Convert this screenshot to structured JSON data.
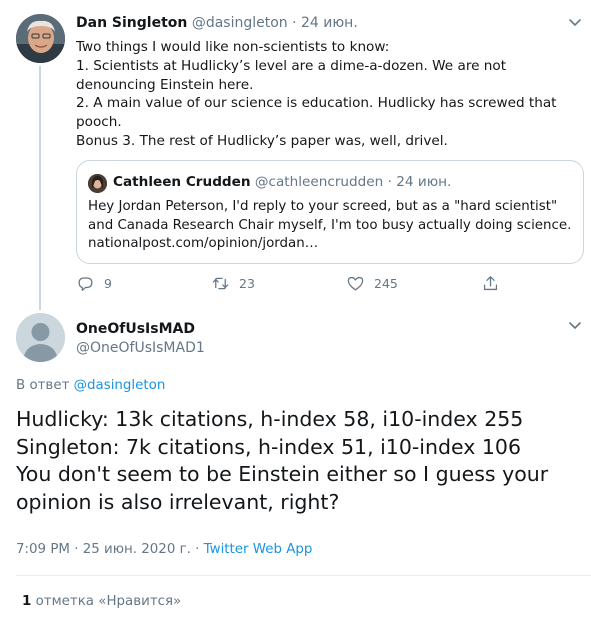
{
  "parent_tweet": {
    "author_name": "Dan Singleton",
    "handle": "@dasingleton",
    "separator": "·",
    "date": "24 июн.",
    "lines": [
      "Two things I would like non-scientists to know:",
      "1. Scientists at Hudlicky’s level are a dime-a-dozen. We are not denouncing Einstein here.",
      "2. A main value of our science is education. Hudlicky has screwed that pooch.",
      "Bonus 3. The rest of Hudlicky’s paper was, well, drivel."
    ],
    "quoted": {
      "author_name": "Cathleen Crudden",
      "handle": "@cathleencrudden",
      "separator": "·",
      "date": "24 июн.",
      "text": "Hey Jordan Peterson, I'd reply to your screed, but as a \"hard scientist\" and Canada Research Chair myself, I'm too busy actually doing science. nationalpost.com/opinion/jordan…"
    },
    "actions": {
      "reply_count": "9",
      "retweet_count": "23",
      "like_count": "245"
    }
  },
  "main_tweet": {
    "author_name": "OneOfUsIsMAD",
    "handle": "@OneOfUsIsMAD1",
    "reply_prefix": "В ответ",
    "reply_handle": "@dasingleton",
    "lines": [
      "Hudlicky: 13k citations, h-index 58, i10-index 255",
      "Singleton: 7k citations, h-index 51, i10-index 106",
      "You don't seem to be Einstein either so I guess your opinion is also irrelevant, right?"
    ],
    "timestamp": "7:09 PM · 25 июн. 2020 г.",
    "meta_separator": " · ",
    "via": "Twitter Web App",
    "likes_count": "1",
    "likes_label": " отметка «Нравится»"
  },
  "colors": {
    "text": "#14171a",
    "secondary": "#657786",
    "link": "#1b95e0",
    "border": "#ccd6dd"
  }
}
